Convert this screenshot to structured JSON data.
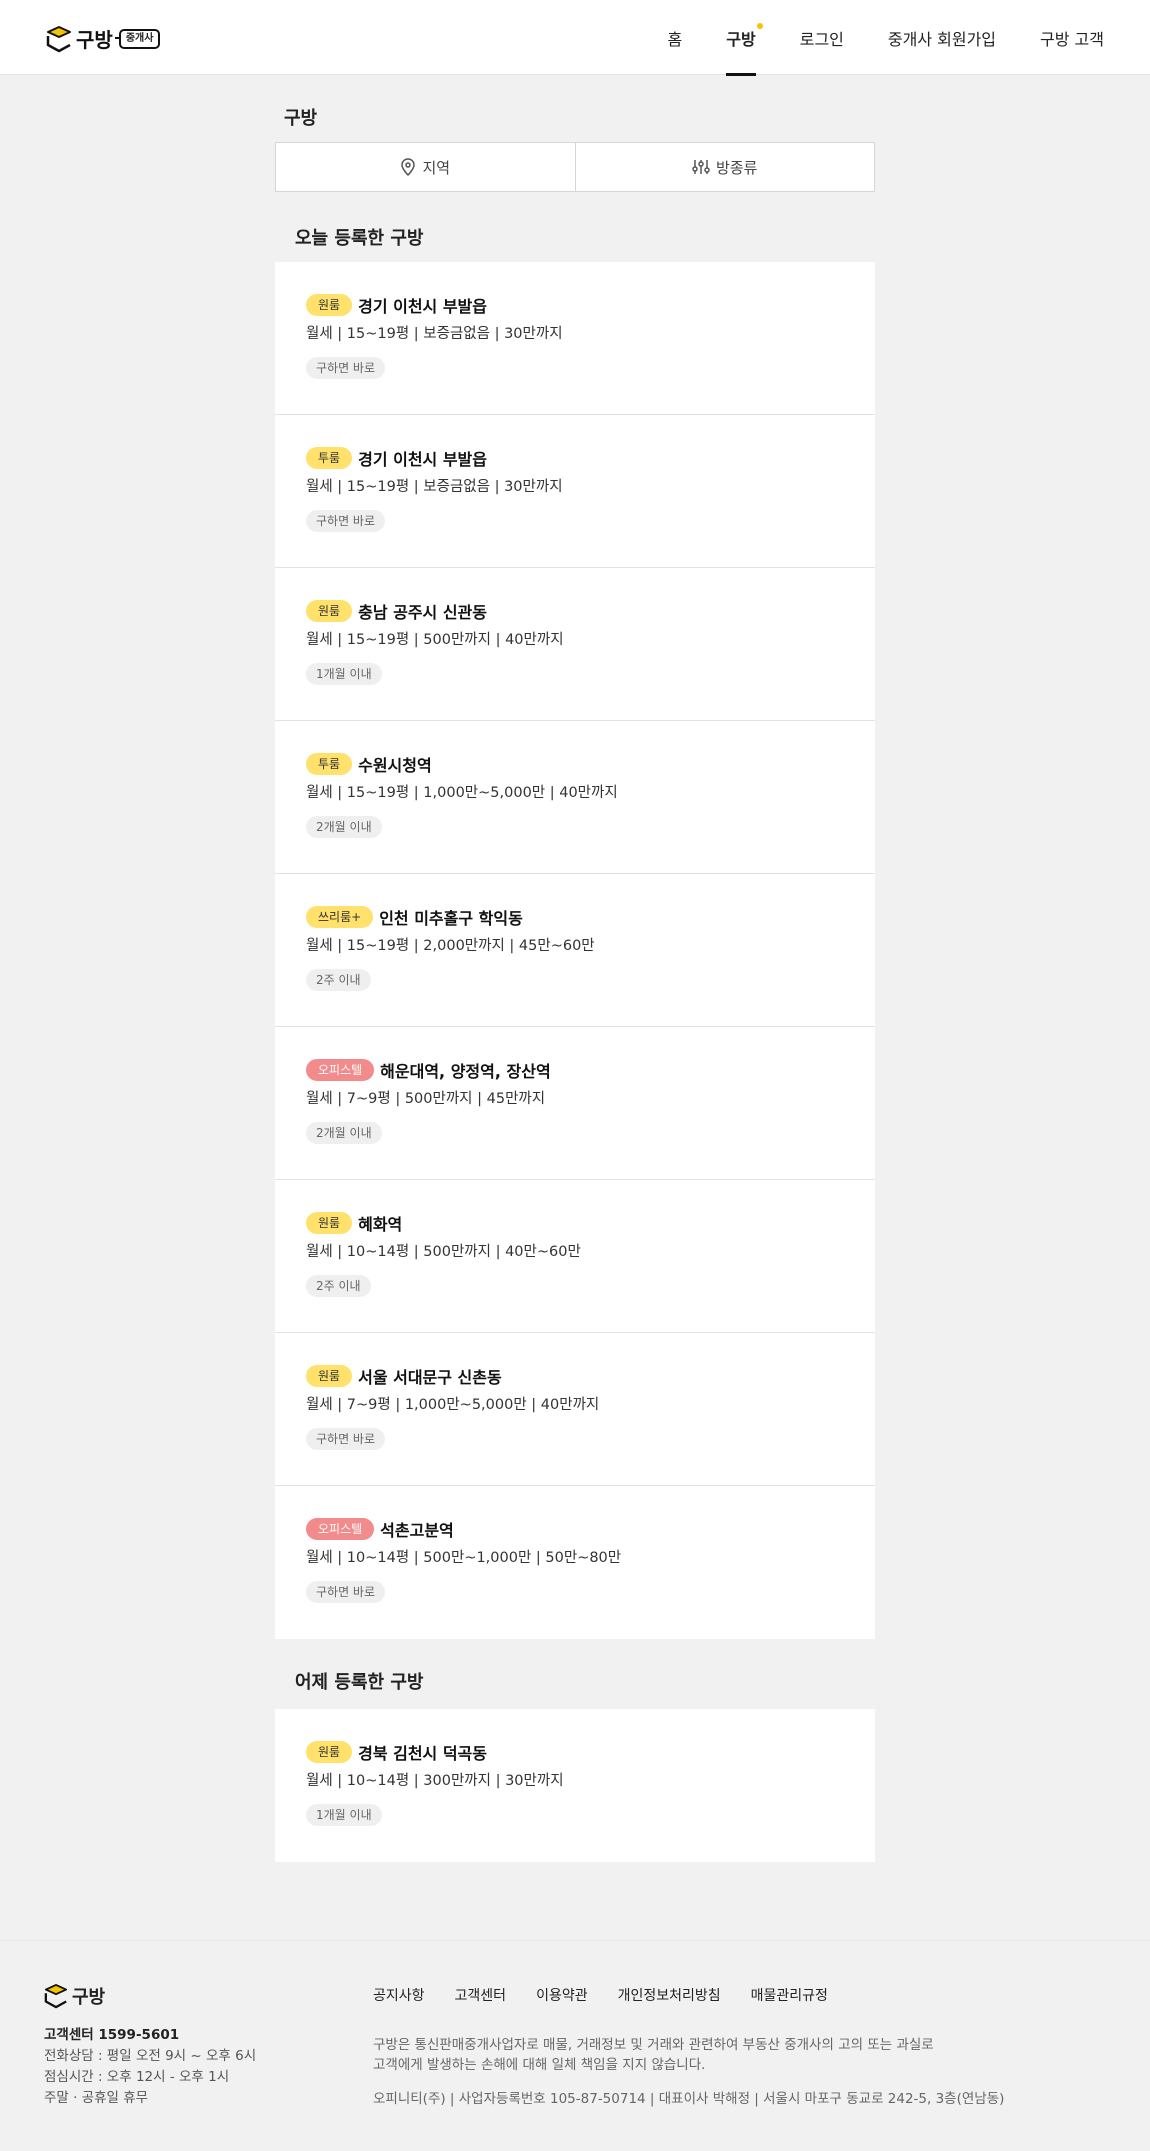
{
  "header": {
    "logo_text": "구방",
    "logo_badge": "중개사",
    "nav": [
      {
        "label": "홈",
        "active": false
      },
      {
        "label": "구방",
        "active": true
      },
      {
        "label": "로그인",
        "active": false
      },
      {
        "label": "중개사 회원가입",
        "active": false
      },
      {
        "label": "구방 고객",
        "active": false
      }
    ]
  },
  "page": {
    "title": "구방",
    "filter_region": "지역",
    "filter_room_type": "방종류"
  },
  "sections": [
    {
      "title": "오늘 등록한 구방",
      "items": [
        {
          "tag": "원룸",
          "tag_type": "normal",
          "title": "경기 이천시 부발읍",
          "detail": "월세 | 15~19평 | 보증금없음 | 30만까지",
          "status": "구하면 바로"
        },
        {
          "tag": "투룸",
          "tag_type": "normal",
          "title": "경기 이천시 부발읍",
          "detail": "월세 | 15~19평 | 보증금없음 | 30만까지",
          "status": "구하면 바로"
        },
        {
          "tag": "원룸",
          "tag_type": "normal",
          "title": "충남 공주시 신관동",
          "detail": "월세 | 15~19평 | 500만까지 | 40만까지",
          "status": "1개월 이내"
        },
        {
          "tag": "투룸",
          "tag_type": "normal",
          "title": "수원시청역",
          "detail": "월세 | 15~19평 | 1,000만~5,000만 | 40만까지",
          "status": "2개월 이내"
        },
        {
          "tag": "쓰리룸+",
          "tag_type": "normal",
          "title": "인천 미추홀구 학익동",
          "detail": "월세 | 15~19평 | 2,000만까지 | 45만~60만",
          "status": "2주 이내"
        },
        {
          "tag": "오피스텔",
          "tag_type": "office",
          "title": "해운대역, 양정역, 장산역",
          "detail": "월세 | 7~9평 | 500만까지 | 45만까지",
          "status": "2개월 이내"
        },
        {
          "tag": "원룸",
          "tag_type": "normal",
          "title": "혜화역",
          "detail": "월세 | 10~14평 | 500만까지 | 40만~60만",
          "status": "2주 이내"
        },
        {
          "tag": "원룸",
          "tag_type": "normal",
          "title": "서울 서대문구 신촌동",
          "detail": "월세 | 7~9평 | 1,000만~5,000만 | 40만까지",
          "status": "구하면 바로"
        },
        {
          "tag": "오피스텔",
          "tag_type": "office",
          "title": "석촌고분역",
          "detail": "월세 | 10~14평 | 500만~1,000만 | 50만~80만",
          "status": "구하면 바로"
        }
      ]
    },
    {
      "title": "어제 등록한 구방",
      "items": [
        {
          "tag": "원룸",
          "tag_type": "normal",
          "title": "경북 김천시 덕곡동",
          "detail": "월세 | 10~14평 | 300만까지 | 30만까지",
          "status": "1개월 이내"
        }
      ]
    }
  ],
  "footer": {
    "logo_text": "구방",
    "cs_center": "고객센터 1599-5601",
    "hours": "전화상담 : 평일 오전 9시 ~ 오후 6시",
    "lunch": "점심시간 : 오후 12시 - 오후 1시",
    "holiday": "주말 · 공휴일 휴무",
    "links": [
      "공지사항",
      "고객센터",
      "이용약관",
      "개인정보처리방침",
      "매물관리규정"
    ],
    "desc_line1": "구방은 통신판매중개사업자로 매물, 거래정보 및 거래와 관련하여 부동산 중개사의 고의 또는 과실로",
    "desc_line2": "고객에게 발생하는 손해에 대해 일체 책임을 지지 않습니다.",
    "corp": "오피니티(주) | 사업자등록번호 105-87-50714 | 대표이사 박해정 | 서울시 마포구 동교로 242-5, 3층(연남동)"
  },
  "colors": {
    "tag_yellow": "#ffe16b",
    "tag_office": "#f28b8b",
    "nav_dot": "#f5c400"
  }
}
